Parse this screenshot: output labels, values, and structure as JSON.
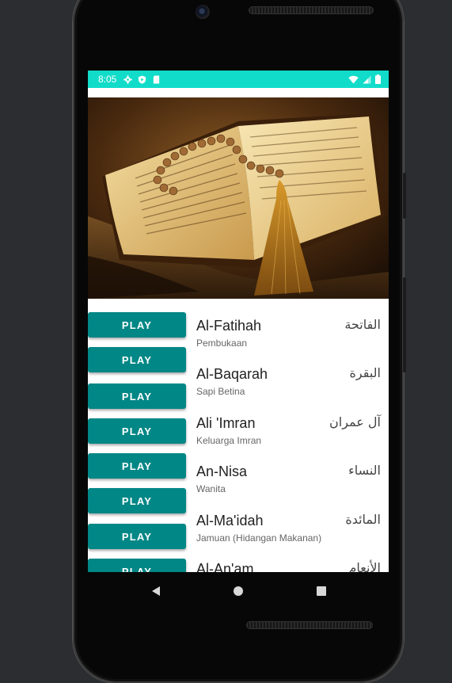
{
  "status_bar": {
    "time": "8:05",
    "left_icons": [
      "gear-icon",
      "play-protect-icon",
      "sd-card-icon"
    ],
    "right_icons": [
      "wifi-icon",
      "signal-icon",
      "battery-icon"
    ],
    "color": "#11dcc9"
  },
  "hero": {
    "image": "open-quran-with-prayer-beads"
  },
  "surahs": [
    {
      "name": "Al-Fatihah",
      "meaning": "Pembukaan",
      "arabic": "الفاتحة",
      "button": "PLAY"
    },
    {
      "name": "Al-Baqarah",
      "meaning": "Sapi Betina",
      "arabic": "البقرة",
      "button": "PLAY"
    },
    {
      "name": "Ali 'Imran",
      "meaning": "Keluarga Imran",
      "arabic": "آل عمران",
      "button": "PLAY"
    },
    {
      "name": "An-Nisa",
      "meaning": "Wanita",
      "arabic": "النساء",
      "button": "PLAY"
    },
    {
      "name": "Al-Ma'idah",
      "meaning": "Jamuan (Hidangan Makanan)",
      "arabic": "المائدة",
      "button": "PLAY"
    },
    {
      "name": "Al-An'am",
      "meaning": "",
      "arabic": "الأنعام",
      "button": "PLAY"
    }
  ],
  "extra_buttons": [
    "PLAY",
    "PLAY"
  ],
  "nav": {
    "back": "back-icon",
    "home": "home-icon",
    "recents": "recents-icon"
  },
  "colors": {
    "accent": "#018786",
    "status": "#11dcc9"
  }
}
